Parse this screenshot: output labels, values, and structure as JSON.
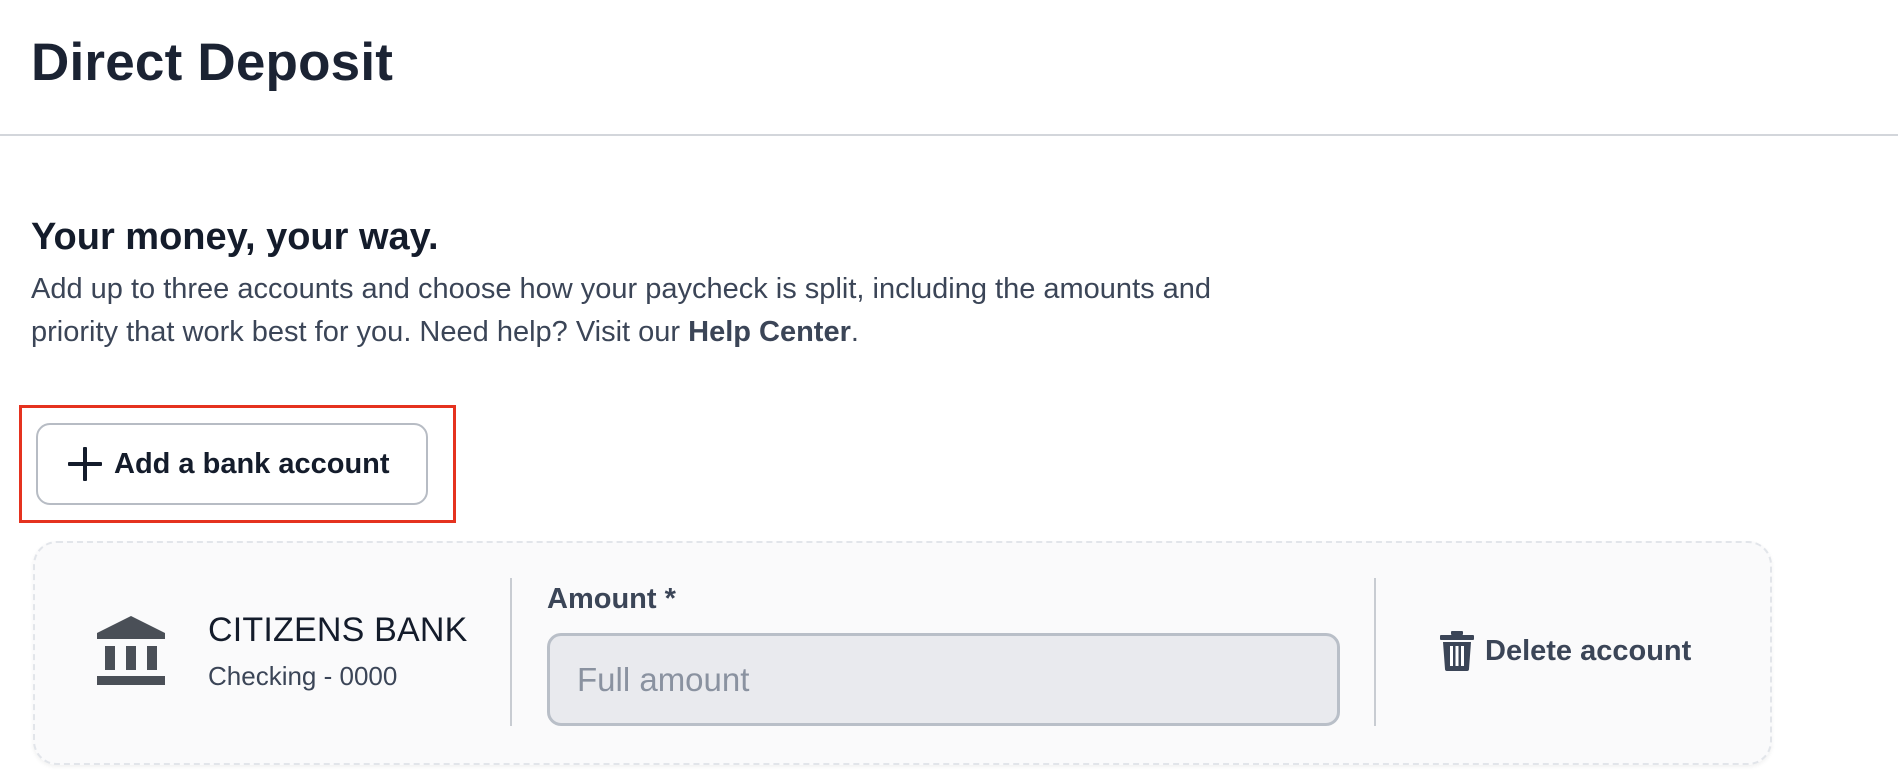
{
  "header": {
    "title": "Direct Deposit"
  },
  "intro": {
    "heading": "Your money, your way.",
    "text_before_link": "Add up to three accounts and choose how your paycheck is split, including the amounts and priority that work best for you. Need help? Visit our ",
    "help_link": "Help Center",
    "text_after_link": "."
  },
  "actions": {
    "add_account_label": "Add a bank account",
    "add_account_icon": "plus-icon",
    "highlight_color": "#e5321f"
  },
  "account": {
    "icon": "bank-icon",
    "bank_name": "CITIZENS BANK",
    "account_detail": "Checking - 0000",
    "amount_label": "Amount *",
    "amount_placeholder": "Full amount",
    "amount_value": "",
    "delete_icon": "trash-icon",
    "delete_label": "Delete account"
  }
}
